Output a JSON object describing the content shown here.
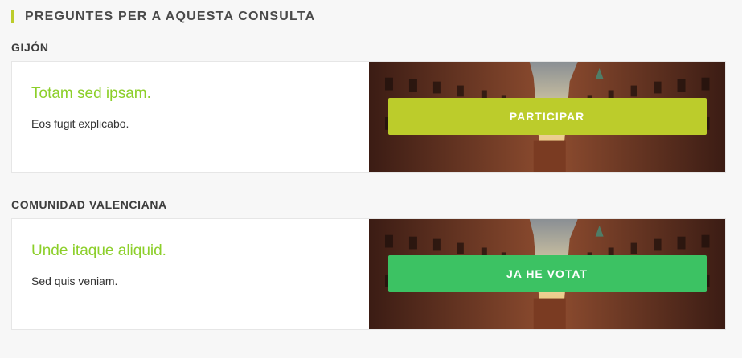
{
  "section": {
    "title": "PREGUNTES PER A AQUESTA CONSULTA"
  },
  "groups": [
    {
      "label": "GIJÓN",
      "question_title": "Totam sed ipsam.",
      "question_description": "Eos fugit explicabo.",
      "button_label": "PARTICIPAR",
      "button_color": "#bccc2b"
    },
    {
      "label": "COMUNIDAD VALENCIANA",
      "question_title": "Unde itaque aliquid.",
      "question_description": "Sed quis veniam.",
      "button_label": "JA HE VOTAT",
      "button_color": "#3cc263"
    }
  ],
  "colors": {
    "accent": "#bccc2b",
    "question_title": "#8ccf2a",
    "background": "#f7f7f7"
  }
}
